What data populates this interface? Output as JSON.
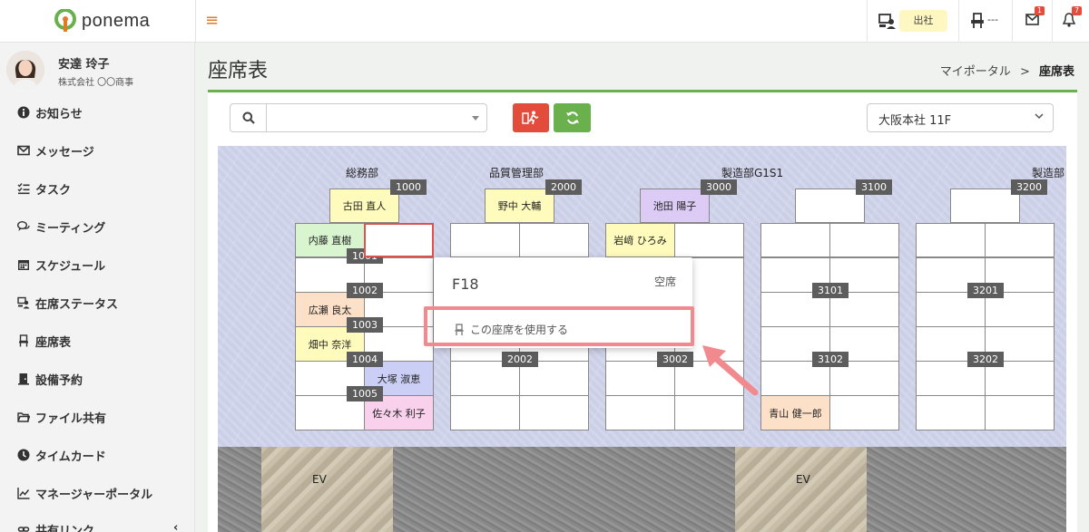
{
  "app": {
    "name": "ponema"
  },
  "topbar": {
    "attendance_label": "出社",
    "seat_status": "---",
    "mail_count": "1",
    "notification_count": "7"
  },
  "user": {
    "name": "安達 玲子",
    "company": "株式会社 〇〇商事"
  },
  "sidebar": {
    "items": [
      {
        "label": "お知らせ",
        "icon": "info-icon"
      },
      {
        "label": "メッセージ",
        "icon": "envelope-icon"
      },
      {
        "label": "タスク",
        "icon": "tasks-icon"
      },
      {
        "label": "ミーティング",
        "icon": "chat-icon"
      },
      {
        "label": "スケジュール",
        "icon": "calendar-icon"
      },
      {
        "label": "在席ステータス",
        "icon": "presence-icon"
      },
      {
        "label": "座席表",
        "icon": "chair-icon"
      },
      {
        "label": "設備予約",
        "icon": "door-icon"
      },
      {
        "label": "ファイル共有",
        "icon": "folder-icon"
      },
      {
        "label": "タイムカード",
        "icon": "clock-icon"
      },
      {
        "label": "マネージャーポータル",
        "icon": "chart-icon"
      },
      {
        "label": "共有リンク",
        "icon": "link-icon"
      }
    ]
  },
  "page": {
    "title": "座席表",
    "breadcrumb": {
      "parent": "マイポータル",
      "separator": ">",
      "current": "座席表"
    }
  },
  "toolbar": {
    "search_value": "",
    "floor": "大阪本社 11F"
  },
  "map": {
    "departments": [
      "総務部",
      "品質管理部",
      "製造部G1S1",
      "製造部"
    ],
    "block_tags": [
      "1000",
      "2000",
      "3000",
      "3100",
      "3200"
    ],
    "seat_tags": [
      "1001",
      "1002",
      "1003",
      "1004",
      "1005",
      "2002",
      "3002",
      "3101",
      "3102",
      "3201",
      "3202"
    ],
    "occupants": {
      "b1_head": "古田 直人",
      "b1_r0c0": "内藤 直樹",
      "b1_r2c0": "広瀬 良太",
      "b1_r3c0": "畑中 奈洋",
      "b1_r4c1": "大塚 淑恵",
      "b1_r5c1": "佐々木 利子",
      "b2_head": "野中 大輔",
      "b3_head": "池田 陽子",
      "b3_r0c0": "岩﨑 ひろみ",
      "b4_r5c0": "青山 健一郎"
    },
    "elevator_label": "EV"
  },
  "popup": {
    "seat": "F18",
    "status": "空席",
    "action": "この座席を使用する"
  },
  "colors": {
    "accent_green": "#6ab04c",
    "accent_red": "#e34b3b",
    "seat_yellow": "#fffbbd",
    "seat_green": "#d8f5d0",
    "seat_orange": "#fde0c8",
    "seat_purple": "#dcccf5",
    "seat_lavender": "#cccff5",
    "seat_pink": "#f9d1ec",
    "highlight": "#f08a8f"
  }
}
